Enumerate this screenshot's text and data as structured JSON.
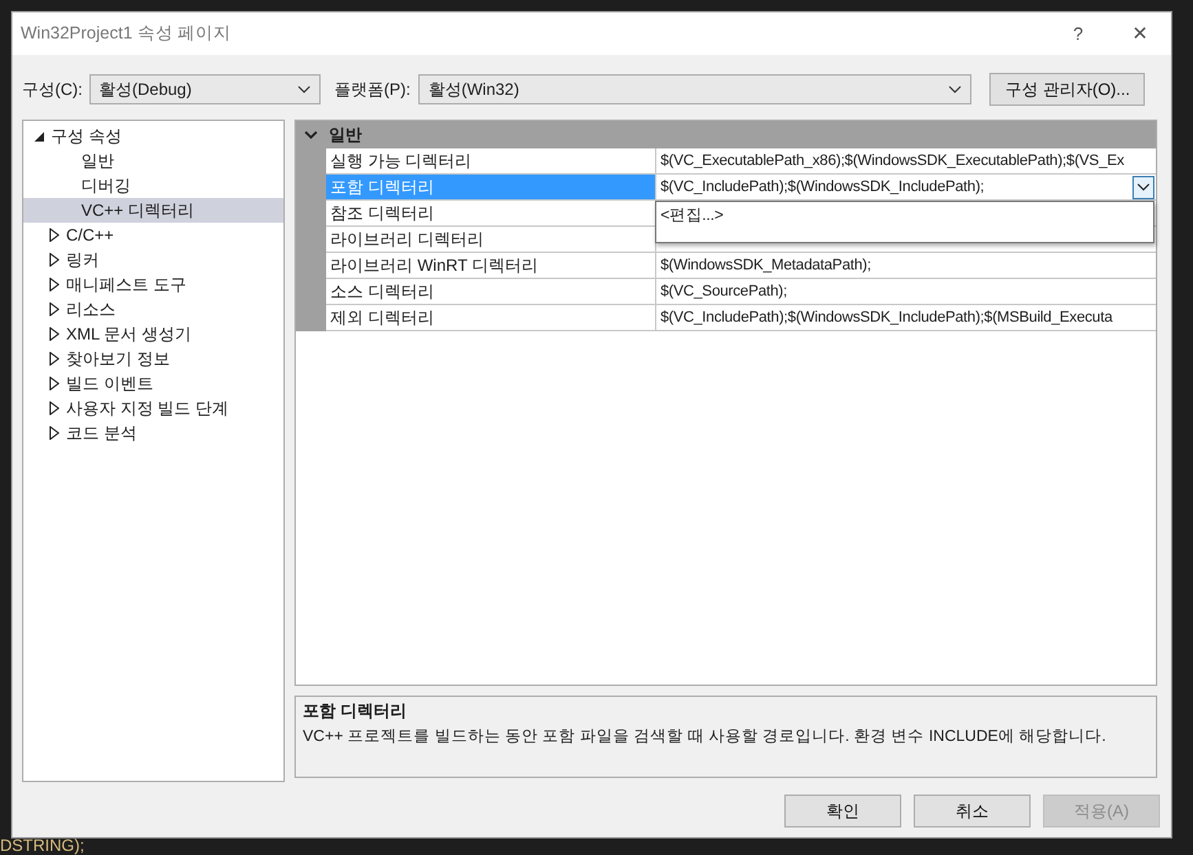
{
  "editor_background": {
    "lines": [
      {
        "text": "DSTRING);"
      }
    ]
  },
  "window": {
    "title": "Win32Project1 속성 페이지",
    "help": "?",
    "close": "✕"
  },
  "config_bar": {
    "configuration_label": "구성(C):",
    "configuration_value": "활성(Debug)",
    "platform_label": "플랫폼(P):",
    "platform_value": "활성(Win32)",
    "manager_button": "구성 관리자(O)..."
  },
  "tree": {
    "items": [
      {
        "label": "구성 속성",
        "expanded": true,
        "selected": false,
        "children": [
          {
            "label": "일반",
            "selected": false
          },
          {
            "label": "디버깅",
            "selected": false
          },
          {
            "label": "VC++ 디렉터리",
            "selected": true
          },
          {
            "label": "C/C++",
            "expanded": false,
            "selected": false
          },
          {
            "label": "링커",
            "expanded": false,
            "selected": false
          },
          {
            "label": "매니페스트 도구",
            "expanded": false,
            "selected": false
          },
          {
            "label": "리소스",
            "expanded": false,
            "selected": false
          },
          {
            "label": "XML 문서 생성기",
            "expanded": false,
            "selected": false
          },
          {
            "label": "찾아보기 정보",
            "expanded": false,
            "selected": false
          },
          {
            "label": "빌드 이벤트",
            "expanded": false,
            "selected": false
          },
          {
            "label": "사용자 지정 빌드 단계",
            "expanded": false,
            "selected": false
          },
          {
            "label": "코드 분석",
            "expanded": false,
            "selected": false
          }
        ]
      }
    ]
  },
  "property_grid": {
    "group": {
      "label": "일반",
      "expanded": true
    },
    "rows": [
      {
        "name": "실행 가능 디렉터리",
        "value": "$(VC_ExecutablePath_x86);$(WindowsSDK_ExecutablePath);$(VS_Ex",
        "selected": false
      },
      {
        "name": "포함 디렉터리",
        "value": "$(VC_IncludePath);$(WindowsSDK_IncludePath);",
        "selected": true,
        "dropdown": {
          "open": true,
          "options": [
            "<편집...>"
          ]
        }
      },
      {
        "name": "참조 디렉터리",
        "selected": false
      },
      {
        "name": "라이브러리 디렉터리",
        "selected": false
      },
      {
        "name": "라이브러리 WinRT 디렉터리",
        "value": "$(WindowsSDK_MetadataPath);",
        "selected": false
      },
      {
        "name": "소스 디렉터리",
        "value": "$(VC_SourcePath);",
        "selected": false
      },
      {
        "name": "제외 디렉터리",
        "value": "$(VC_IncludePath);$(WindowsSDK_IncludePath);$(MSBuild_Executa",
        "selected": false
      }
    ]
  },
  "description": {
    "title": "포함 디렉터리",
    "text": "VC++ 프로젝트를 빌드하는 동안 포함 파일을 검색할 때 사용할 경로입니다.  환경 변수 INCLUDE에 해당합니다."
  },
  "buttons": [
    {
      "label": "확인",
      "disabled": false
    },
    {
      "label": "취소",
      "disabled": false
    },
    {
      "label": "적용(A)",
      "disabled": true
    }
  ]
}
